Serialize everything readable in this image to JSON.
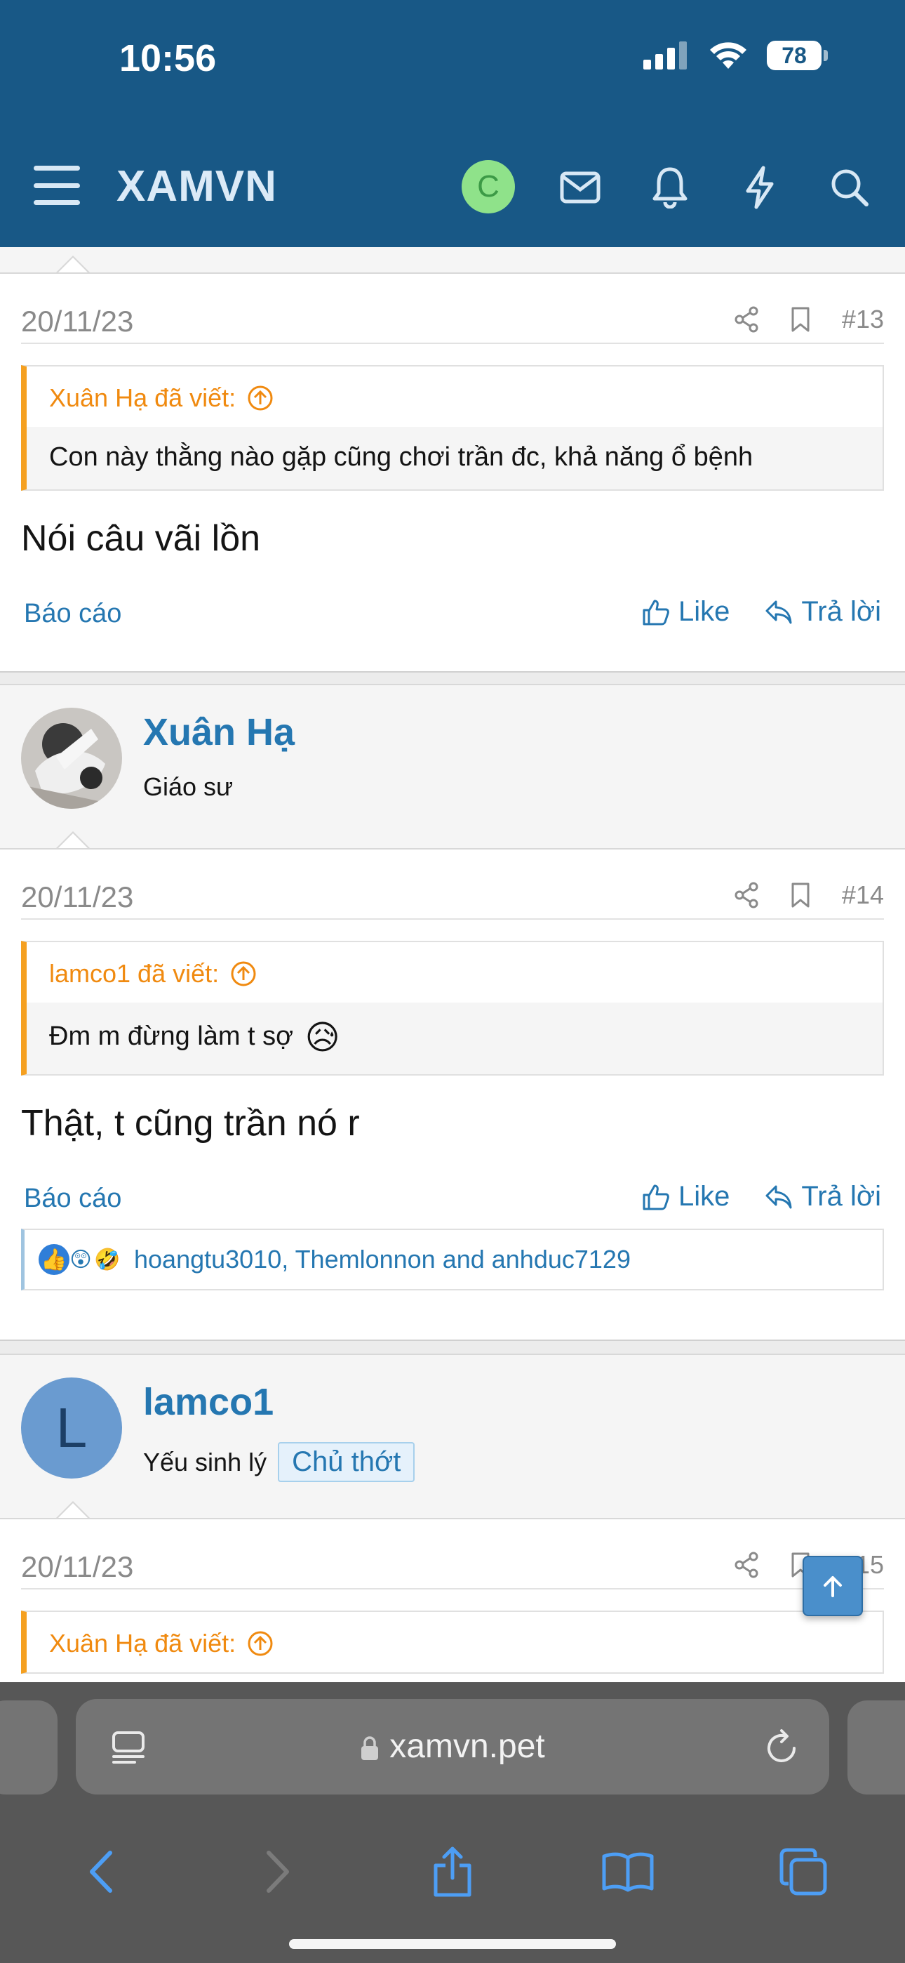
{
  "status_bar": {
    "time": "10:56",
    "battery": "78"
  },
  "header": {
    "logo": "XAMVN",
    "avatar_letter": "C"
  },
  "posts": [
    {
      "date": "20/11/23",
      "number": "#13",
      "quote_author": "Xuân Hạ đã viết:",
      "quote_text": "Con này thằng nào gặp cũng chơi trần đc, khả năng ổ bệnh",
      "text": "Nói câu vãi lồn",
      "report": "Báo cáo",
      "like": "Like",
      "reply": "Trả lời"
    },
    {
      "user_name": "Xuân Hạ",
      "user_title": "Giáo sư",
      "date": "20/11/23",
      "number": "#14",
      "quote_author": "lamco1 đã viết:",
      "quote_text": "Đm m đừng làm t sợ",
      "quote_emoji": "😥",
      "text": "Thật, t cũng trần nó r",
      "report": "Báo cáo",
      "like": "Like",
      "reply": "Trả lời",
      "reactions_text": "hoangtu3010, Themlonnon and anhduc7129"
    },
    {
      "user_name": "lamco1",
      "user_avatar_letter": "L",
      "user_title": "Yếu sinh lý",
      "user_badge": "Chủ thớt",
      "date": "20/11/23",
      "number": "#15",
      "quote_author": "Xuân Hạ đã viết:"
    }
  ],
  "safari": {
    "url": "xamvn.pet"
  },
  "colors": {
    "header_bg": "#185886",
    "link": "#2577b1",
    "quote_accent": "#f5a020",
    "safari_bg": "#575757"
  }
}
